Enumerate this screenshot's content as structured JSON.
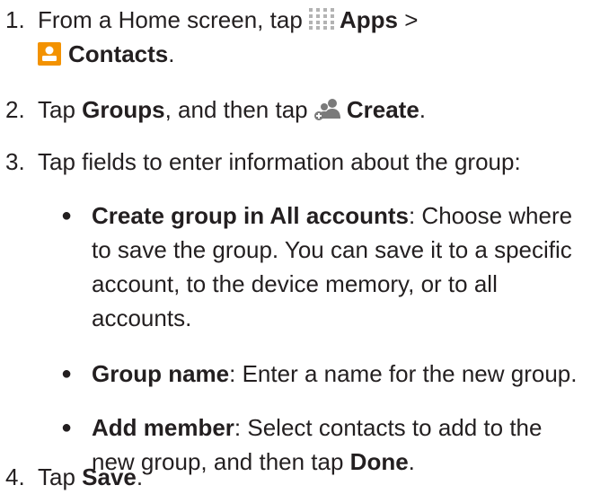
{
  "steps": [
    {
      "number": "1.",
      "line1_before": "From a Home screen, tap ",
      "apps_label": "Apps",
      "line1_after": " >",
      "contacts_label": "Contacts",
      "line2_after": "."
    },
    {
      "number": "2.",
      "before": "Tap ",
      "groups_label": "Groups",
      "middle": ", and then tap ",
      "create_label": "Create",
      "after": "."
    },
    {
      "number": "3.",
      "text": "Tap fields to enter information about the group:"
    },
    {
      "number": "4.",
      "before": "Tap ",
      "save_label": "Save",
      "after": "."
    }
  ],
  "bullets": [
    {
      "label": "Create group in All accounts",
      "line1": ": Choose where",
      "line2": "to save the group. You can save it to a specific",
      "line3": "account, to the device memory, or to all",
      "line4": "accounts."
    },
    {
      "label": "Group name",
      "text": ": Enter a name for the new group."
    },
    {
      "label": "Add member",
      "line1": ": Select contacts to add to the",
      "line2_before": "new group, and then tap ",
      "done_label": "Done",
      "line2_after": "."
    }
  ],
  "icons": {
    "apps": "apps-grid-icon",
    "contacts": "contacts-icon",
    "create_group": "create-group-icon"
  },
  "colors": {
    "text": "#231f20",
    "apps_icon": "#b3b3b3",
    "contacts_icon": "#f39200",
    "create_icon": "#7a7a7a"
  }
}
